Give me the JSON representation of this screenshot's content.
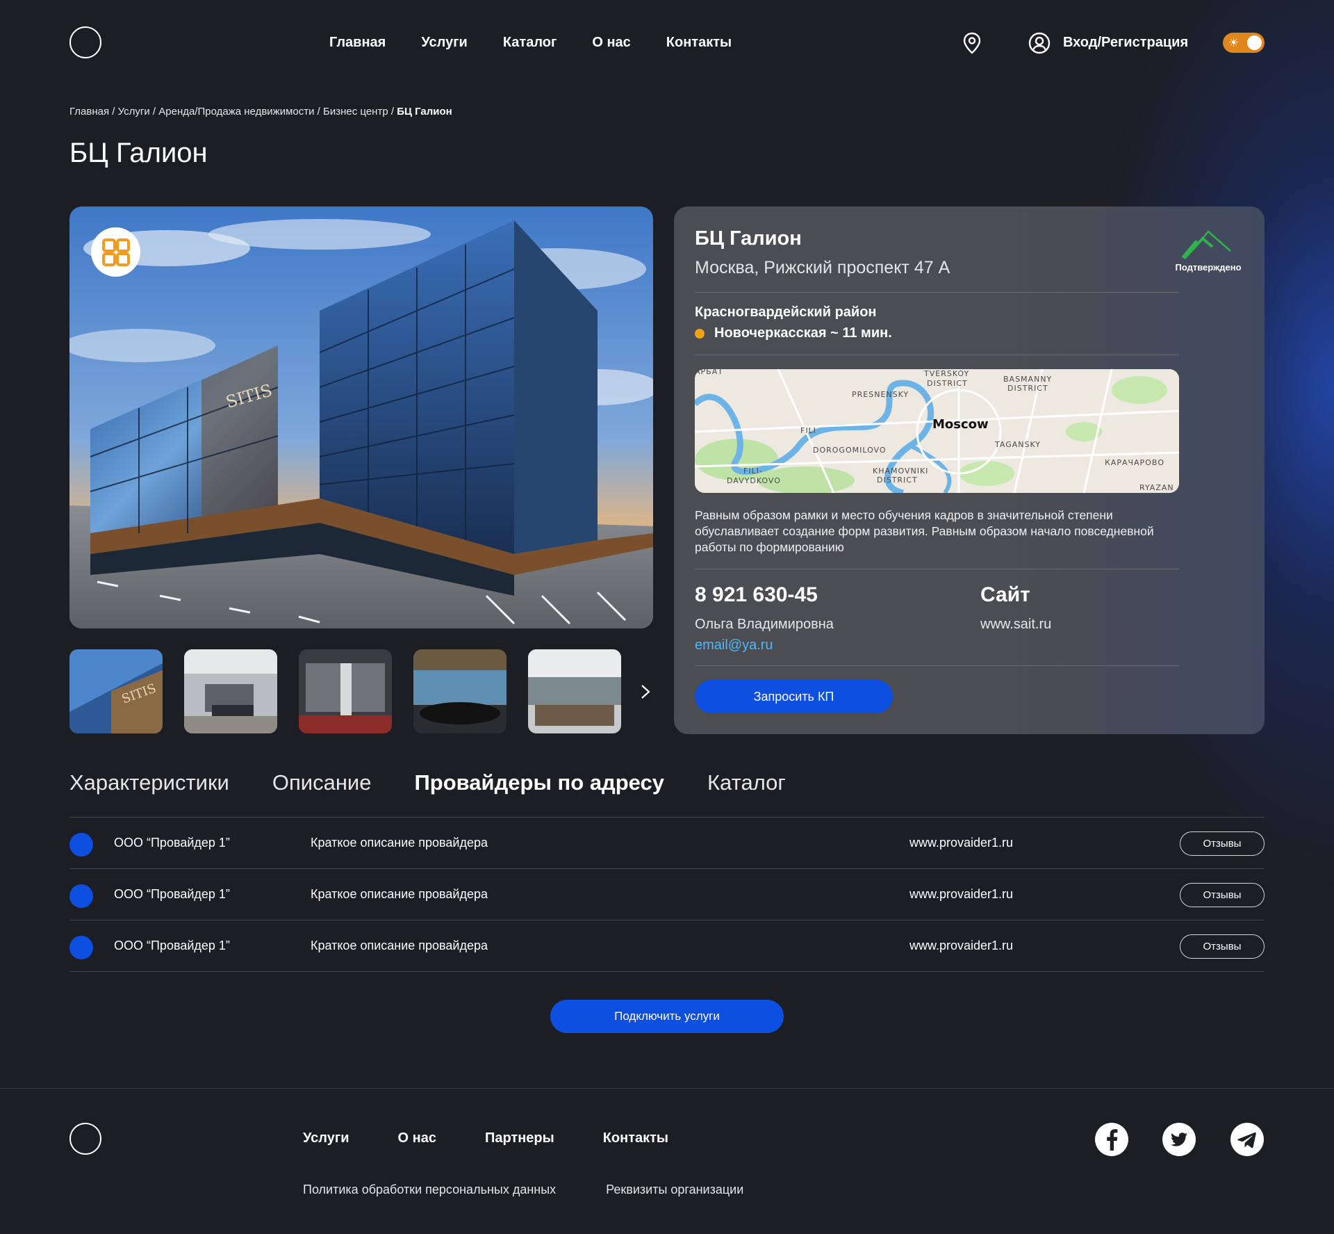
{
  "header": {
    "nav": [
      "Главная",
      "Услуги",
      "Каталог",
      "О нас",
      "Контакты"
    ],
    "login_label": "Вход/Регистрация",
    "icons": {
      "location": "map-pin-icon",
      "user": "user-icon",
      "theme": "sun-icon"
    },
    "theme_toggle_on": true,
    "accent_color": "#e0861a"
  },
  "breadcrumb": {
    "items": [
      "Главная",
      "Услуги",
      "Аренда/Продажа недвижимости",
      "Бизнес центр"
    ],
    "current": "БЦ Галион"
  },
  "page_title": "БЦ Галион",
  "gallery": {
    "main_signage": "SITIS",
    "thumbnails_count": 5,
    "next_icon": "chevron-right-icon"
  },
  "card": {
    "title": "БЦ Галион",
    "address": "Москва, Рижский проспект 47 А",
    "verified_label": "Подтверждено",
    "district": "Красногвардейский район",
    "metro": "Новочеркасская ~ 11 мин.",
    "metro_color": "#f2a20f",
    "map_labels": {
      "center": "Moscow",
      "tversky": "TVERSKOY",
      "tversky2": "DISTRICT",
      "basmanny": "BASMANNY",
      "basmanny2": "DISTRICT",
      "presnensky": "PRESNENSKY",
      "fili": "FILI",
      "dorogomilovo": "DOROGOMILOVO",
      "tagansky": "TAGANSKY",
      "fili_davydkovo": "FILI-",
      "fili_davydkovo2": "DAVYDKOVO",
      "khamovniki": "KHAMOVNIKI",
      "khamovniki2": "DISTRICT",
      "karacharovo": "КАРАЧАРОВО",
      "ryazan": "RYAZAN",
      "arbat": "АРБАТ"
    },
    "description": "Равным образом рамки и место обучения кадров в значительной степени обуславливает создание форм развития. Равным образом начало повседневной работы по формированию",
    "phone": "8 921 630-45",
    "contact_name": "Ольга Владимировна",
    "email": "email@ya.ru",
    "site_label": "Сайт",
    "site_url": "www.sait.ru",
    "request_button": "Запросить КП",
    "button_color": "#0d4fe0"
  },
  "tabs": {
    "items": [
      "Характеристики",
      "Описание",
      "Провайдеры по адресу",
      "Каталог"
    ],
    "active_index": 2
  },
  "providers": [
    {
      "name": "ООО “Провайдер 1”",
      "description": "Краткое описание провайдера",
      "site": "www.provaider1.ru",
      "button": "Отзывы"
    },
    {
      "name": "ООО “Провайдер 1”",
      "description": "Краткое описание провайдера",
      "site": "www.provaider1.ru",
      "button": "Отзывы"
    },
    {
      "name": "ООО “Провайдер 1”",
      "description": "Краткое описание провайдера",
      "site": "www.provaider1.ru",
      "button": "Отзывы"
    }
  ],
  "connect_button": "Подключить услуги",
  "footer": {
    "nav": [
      "Услуги",
      "О нас",
      "Партнеры",
      "Контакты"
    ],
    "links": [
      "Политика обработки персональных данных",
      "Реквизиты организации"
    ],
    "social_icons": [
      "facebook-icon",
      "twitter-icon",
      "telegram-icon"
    ]
  }
}
